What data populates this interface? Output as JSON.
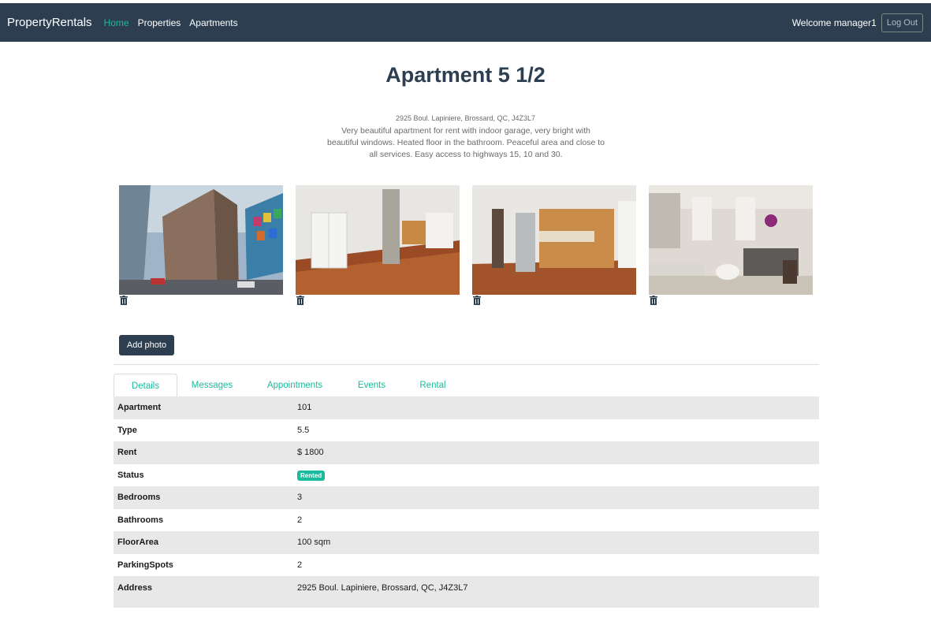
{
  "navbar": {
    "brand": "PropertyRentals",
    "links": [
      "Home",
      "Properties",
      "Apartments"
    ],
    "welcome": "Welcome manager1",
    "logout": "Log Out"
  },
  "page": {
    "title": "Apartment 5 1/2",
    "address": "2925 Boul. Lapiniere, Brossard, QC, J4Z3L7",
    "description": "Very beautiful apartment for rent with indoor garage, very bright with beautiful windows. Heated floor in the bathroom. Peaceful area and close to all services. Easy access to highways 15, 10 and 30."
  },
  "photos": {
    "items": [
      "building-exterior",
      "empty-living-room",
      "kitchen",
      "furnished-bedroom"
    ],
    "delete_icon": "trash-icon",
    "add_label": "Add photo"
  },
  "tabs": [
    "Details",
    "Messages",
    "Appointments",
    "Events",
    "Rental"
  ],
  "details": [
    {
      "label": "Apartment",
      "value": "101"
    },
    {
      "label": "Type",
      "value": "5.5"
    },
    {
      "label": "Rent",
      "value": "$ 1800"
    },
    {
      "label": "Status",
      "value": "Rented"
    },
    {
      "label": "Bedrooms",
      "value": "3"
    },
    {
      "label": "Bathrooms",
      "value": "2"
    },
    {
      "label": "FloorArea",
      "value": "100 sqm"
    },
    {
      "label": "ParkingSpots",
      "value": "2"
    },
    {
      "label": "Address",
      "value": "2925 Boul. Lapiniere, Brossard, QC, J4Z3L7"
    }
  ],
  "colors": {
    "navbar": "#2c3e50",
    "accent": "#18bc9c",
    "row_stripe": "#e8e8e8"
  }
}
